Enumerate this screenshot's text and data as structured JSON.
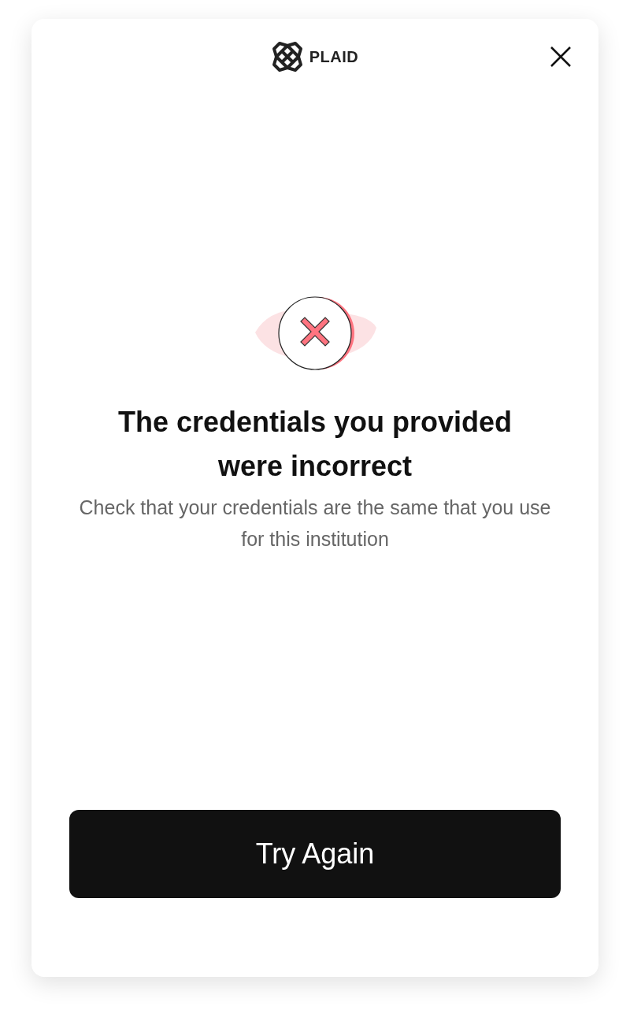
{
  "header": {
    "logo_text": "PLAID"
  },
  "title": "The credentials you provided were incorrect",
  "message": "Check that your credentials are the same that you use for this institution",
  "button": "Try Again"
}
